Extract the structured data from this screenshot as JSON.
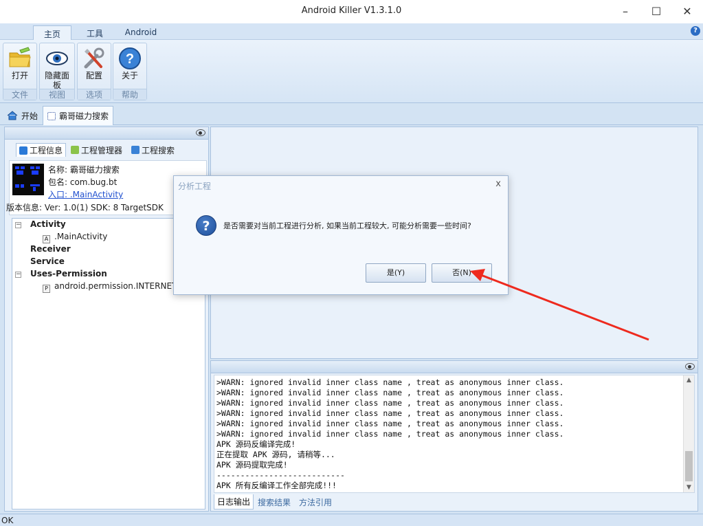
{
  "window": {
    "title": "Android Killer V1.3.1.0"
  },
  "ribbon": {
    "tabs": [
      "主页",
      "工具",
      "Android"
    ],
    "groups": [
      {
        "button": "打开",
        "group": "文件",
        "icon": "folder-icon"
      },
      {
        "button": "隐藏面板",
        "group": "视图",
        "icon": "eye-icon"
      },
      {
        "button": "配置",
        "group": "选项",
        "icon": "tools-icon"
      },
      {
        "button": "关于",
        "group": "帮助",
        "icon": "help-icon"
      }
    ],
    "help_glyph": "?"
  },
  "doc_tabs": [
    "开始",
    "霸哥磁力搜索"
  ],
  "left_panel": {
    "tabs": [
      "工程信息",
      "工程管理器",
      "工程搜索"
    ],
    "info": {
      "name": "名称: 霸哥磁力搜索",
      "package": "包名: com.bug.bt",
      "entry": "入口: .MainActivity",
      "version": "版本信息: Ver: 1.0(1) SDK: 8 TargetSDK"
    },
    "tree": {
      "activity": "Activity",
      "main_activity": ".MainActivity",
      "receiver": "Receiver",
      "service": "Service",
      "uses_permission": "Uses-Permission",
      "permission_internet": "android.permission.INTERNET"
    }
  },
  "log": {
    "lines": [
      ">WARN: ignored invalid inner class name , treat as anonymous inner class.",
      ">WARN: ignored invalid inner class name , treat as anonymous inner class.",
      ">WARN: ignored invalid inner class name , treat as anonymous inner class.",
      ">WARN: ignored invalid inner class name , treat as anonymous inner class.",
      ">WARN: ignored invalid inner class name , treat as anonymous inner class.",
      ">WARN: ignored invalid inner class name , treat as anonymous inner class.",
      "APK 源码反编译完成!",
      "正在提取 APK 源码, 请稍等...",
      "APK 源码提取完成!",
      "---------------------------",
      "APK 所有反编译工作全部完成!!!"
    ],
    "tabs": [
      "日志输出",
      "搜索结果",
      "方法引用"
    ]
  },
  "status": {
    "text": "OK"
  },
  "dialog": {
    "title": "分析工程",
    "message": "是否需要对当前工程进行分析, 如果当前工程较大, 可能分析需要一些时间?",
    "yes_label": "是(Y)",
    "no_label": "否(N)",
    "close_glyph": "x",
    "question_glyph": "?"
  },
  "colors": {
    "accent": "#2b6cc4",
    "annotation_arrow": "#ee2a1e"
  }
}
